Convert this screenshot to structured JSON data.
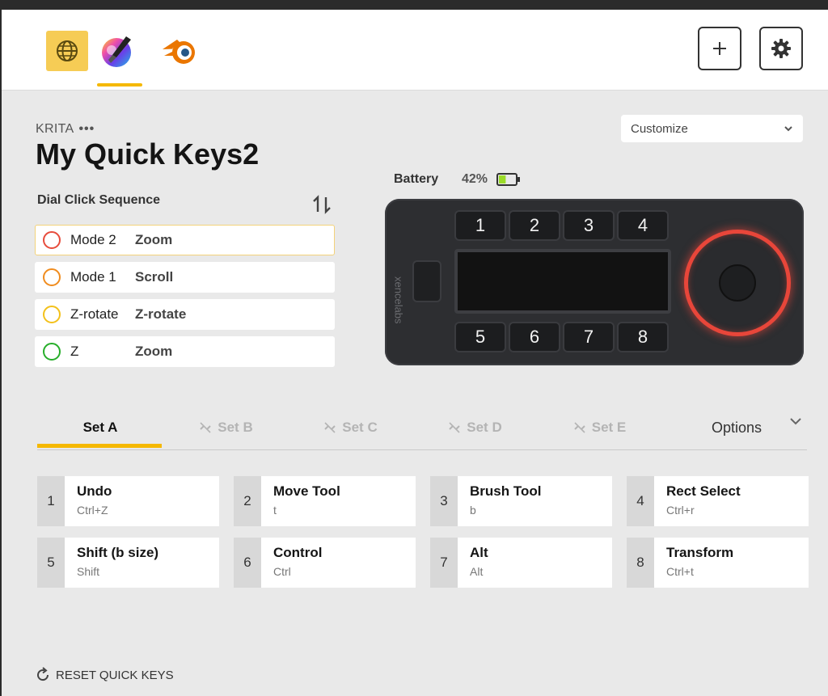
{
  "colors": {
    "accent": "#f5b800",
    "globe_tab_bg": "#f6cc55",
    "dial_ring": "#e8463a",
    "battery_green": "#9bdc28"
  },
  "topbar": {
    "app_icons": [
      "globe-icon",
      "krita-icon",
      "blender-icon"
    ],
    "add_icon": "plus-icon",
    "settings_icon": "gear-icon"
  },
  "header": {
    "app_name": "KRITA",
    "more_label": "•••",
    "profile_title": "My Quick Keys2",
    "customize_label": "Customize"
  },
  "dial": {
    "heading": "Dial Click Sequence",
    "items": [
      {
        "mode": "Mode 2",
        "action": "Zoom",
        "color": "#e74c3c"
      },
      {
        "mode": "Mode 1",
        "action": "Scroll",
        "color": "#f08c1e"
      },
      {
        "mode": "Z-rotate",
        "action": "Z-rotate",
        "color": "#f3c11b"
      },
      {
        "mode": "Z",
        "action": "Zoom",
        "color": "#27ae2a"
      }
    ]
  },
  "device": {
    "battery_label": "Battery",
    "battery_pct": "42%",
    "battery_level": 0.42,
    "brand": "xencelabs",
    "keys": [
      "1",
      "2",
      "3",
      "4",
      "5",
      "6",
      "7",
      "8"
    ]
  },
  "sets": {
    "tabs": [
      {
        "label": "Set A",
        "state": "active"
      },
      {
        "label": "Set B",
        "state": "disabled"
      },
      {
        "label": "Set C",
        "state": "disabled"
      },
      {
        "label": "Set D",
        "state": "disabled"
      },
      {
        "label": "Set E",
        "state": "disabled"
      }
    ],
    "options_label": "Options"
  },
  "quick_keys": [
    {
      "num": "1",
      "name": "Undo",
      "shortcut": "Ctrl+Z"
    },
    {
      "num": "2",
      "name": "Move Tool",
      "shortcut": "t"
    },
    {
      "num": "3",
      "name": "Brush Tool",
      "shortcut": "b"
    },
    {
      "num": "4",
      "name": "Rect Select",
      "shortcut": "Ctrl+r"
    },
    {
      "num": "5",
      "name": "Shift (b size)",
      "shortcut": "Shift"
    },
    {
      "num": "6",
      "name": "Control",
      "shortcut": "Ctrl"
    },
    {
      "num": "7",
      "name": "Alt",
      "shortcut": "Alt"
    },
    {
      "num": "8",
      "name": "Transform",
      "shortcut": "Ctrl+t"
    }
  ],
  "footer": {
    "reset_label": "RESET QUICK KEYS"
  }
}
